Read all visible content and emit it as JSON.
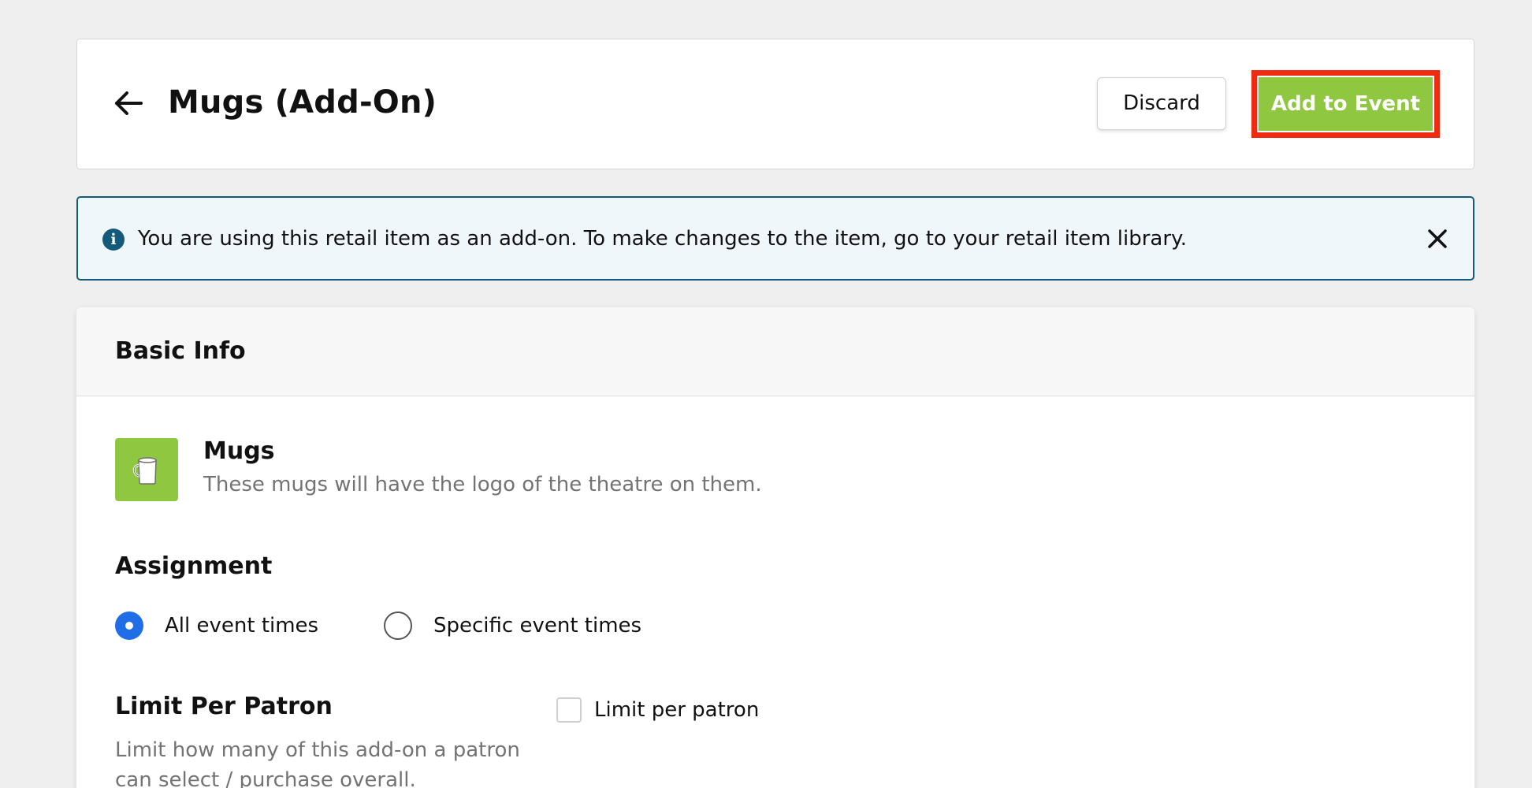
{
  "header": {
    "title": "Mugs (Add-On)",
    "discard_label": "Discard",
    "add_label": "Add to Event"
  },
  "banner": {
    "icon_glyph": "i",
    "text": "You are using this retail item as an add-on. To make changes to the item, go to your retail item library."
  },
  "basic_info": {
    "title": "Basic Info",
    "item": {
      "name": "Mugs",
      "description": "These mugs will have the logo of the theatre on them.",
      "icon": "mug-icon"
    },
    "assignment": {
      "title": "Assignment",
      "options": [
        {
          "label": "All event times",
          "selected": true
        },
        {
          "label": "Specific event times",
          "selected": false
        }
      ]
    },
    "limit": {
      "title": "Limit Per Patron",
      "description": "Limit how many of this add-on a patron can select / purchase overall.",
      "checkbox_label": "Limit per patron",
      "checked": false
    }
  },
  "colors": {
    "accent_green": "#8fc741",
    "highlight_red": "#ee2a10",
    "info_blue": "#145a7a",
    "radio_blue": "#1f6ee8",
    "page_bg": "#efefef"
  }
}
